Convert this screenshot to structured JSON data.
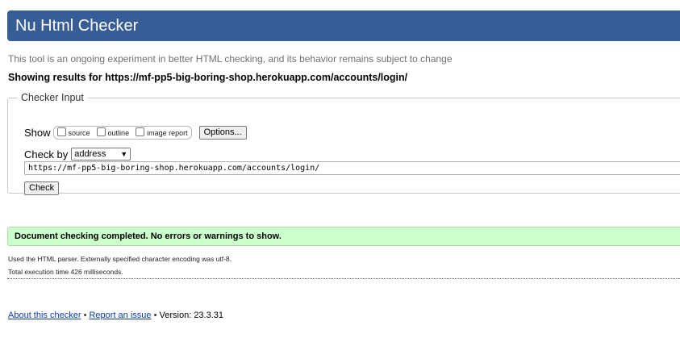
{
  "header": {
    "title": "Nu Html Checker"
  },
  "intro_text": "This tool is an ongoing experiment in better HTML checking, and its behavior remains subject to change",
  "showing_results": "Showing results for https://mf-pp5-big-boring-shop.herokuapp.com/accounts/login/",
  "checker_input": {
    "legend": "Checker Input",
    "show_label": "Show",
    "show_options": [
      {
        "label": "source",
        "checked": false
      },
      {
        "label": "outline",
        "checked": false
      },
      {
        "label": "image report",
        "checked": false
      }
    ],
    "options_button": "Options...",
    "check_by_label": "Check by",
    "check_by_selected": "address",
    "url_value": "https://mf-pp5-big-boring-shop.herokuapp.com/accounts/login/",
    "check_button": "Check"
  },
  "result": {
    "message": "Document checking completed. No errors or warnings to show.",
    "status_color": "#ccffcc",
    "parser_note": "Used the HTML parser. Externally specified character encoding was utf-8.",
    "execution_time": "Total execution time 426 milliseconds."
  },
  "footer": {
    "about_link": "About this checker",
    "report_link": "Report an issue",
    "version_text": "Version: 23.3.31",
    "separator": "•"
  },
  "colors": {
    "header_bg": "#365d95",
    "link": "#0b3cb0"
  }
}
